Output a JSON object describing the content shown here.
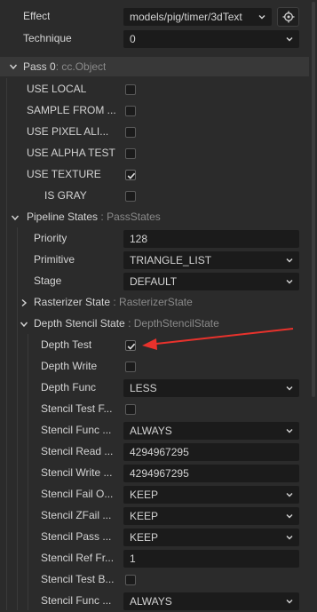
{
  "effect": {
    "label": "Effect",
    "value": "models/pig/timer/3dText"
  },
  "technique": {
    "label": "Technique",
    "value": "0"
  },
  "pass": {
    "label": "Pass 0",
    "type": ": cc.Object"
  },
  "pass_flags": [
    {
      "label": "USE LOCAL",
      "checked": false
    },
    {
      "label": "SAMPLE FROM ...",
      "checked": false
    },
    {
      "label": "USE PIXEL ALI...",
      "checked": false
    },
    {
      "label": "USE ALPHA TEST",
      "checked": false
    },
    {
      "label": "USE TEXTURE",
      "checked": true
    },
    {
      "label": "IS GRAY",
      "checked": false
    }
  ],
  "pipeline": {
    "label": "Pipeline States",
    "type": ": PassStates",
    "priority": {
      "label": "Priority",
      "value": "128"
    },
    "primitive": {
      "label": "Primitive",
      "value": "TRIANGLE_LIST"
    },
    "stage": {
      "label": "Stage",
      "value": "DEFAULT"
    }
  },
  "rasterizer": {
    "label": "Rasterizer State",
    "type": ": RasterizerState"
  },
  "depth_stencil": {
    "label": "Depth Stencil State",
    "type": ": DepthStencilState",
    "depth_test": {
      "label": "Depth Test",
      "checked": true
    },
    "depth_write": {
      "label": "Depth Write",
      "checked": false
    },
    "depth_func": {
      "label": "Depth Func",
      "value": "LESS"
    },
    "stencil_test_front": {
      "label": "Stencil Test F...",
      "checked": false
    },
    "stencil_func_front": {
      "label": "Stencil Func ...",
      "value": "ALWAYS"
    },
    "stencil_read_mask": {
      "label": "Stencil Read ...",
      "value": "4294967295"
    },
    "stencil_write_mask": {
      "label": "Stencil Write ...",
      "value": "4294967295"
    },
    "stencil_fail_op": {
      "label": "Stencil Fail O...",
      "value": "KEEP"
    },
    "stencil_zfail_op": {
      "label": "Stencil ZFail ...",
      "value": "KEEP"
    },
    "stencil_pass_op": {
      "label": "Stencil Pass ...",
      "value": "KEEP"
    },
    "stencil_ref_front": {
      "label": "Stencil Ref Fr...",
      "value": "1"
    },
    "stencil_test_back": {
      "label": "Stencil Test B...",
      "checked": false
    },
    "stencil_func_back": {
      "label": "Stencil Func ...",
      "value": "ALWAYS"
    }
  },
  "colors": {
    "background": "#2b2b2b",
    "field": "#1b1b1b",
    "annotation_arrow": "#e8322c",
    "type_text": "#8a8a8a"
  },
  "icons": {
    "gear": "locate-icon",
    "dropdown": "chevron-down-icon",
    "check": "checkmark-icon"
  }
}
